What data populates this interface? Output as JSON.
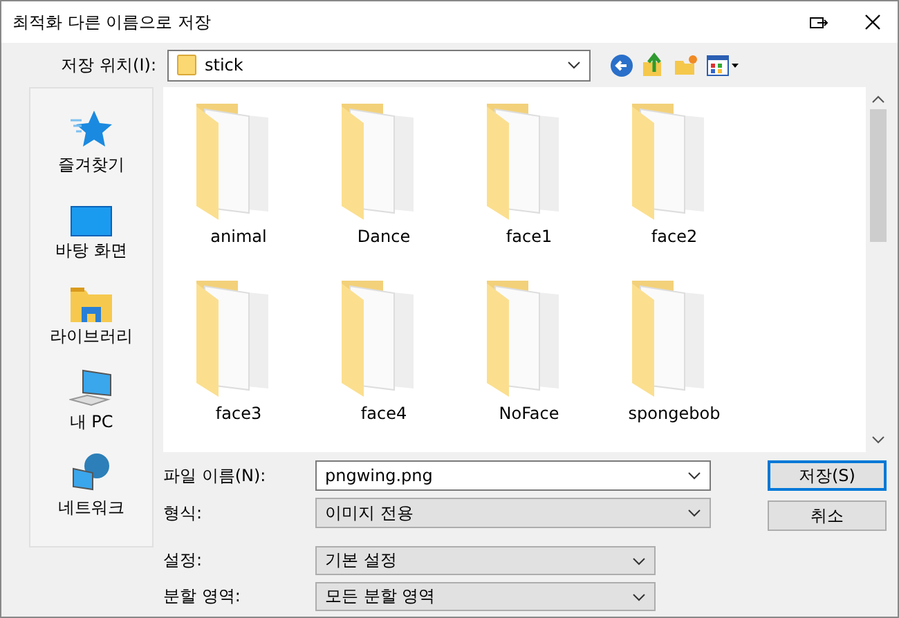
{
  "window": {
    "title": "최적화 다른 이름으로 저장"
  },
  "location": {
    "label": "저장 위치(I):",
    "value": "stick"
  },
  "sidebar": {
    "items": [
      {
        "label": "즐겨찾기",
        "kind": "star"
      },
      {
        "label": "바탕 화면",
        "kind": "desktop"
      },
      {
        "label": "라이브러리",
        "kind": "library"
      },
      {
        "label": "내 PC",
        "kind": "pc"
      },
      {
        "label": "네트워크",
        "kind": "network"
      }
    ]
  },
  "files": [
    {
      "name": "animal"
    },
    {
      "name": "Dance"
    },
    {
      "name": "face1"
    },
    {
      "name": "face2"
    },
    {
      "name": "face3"
    },
    {
      "name": "face4"
    },
    {
      "name": "NoFace"
    },
    {
      "name": "spongebob"
    }
  ],
  "fields": [
    {
      "label": "파일 이름(N):",
      "value": "pngwing.png",
      "kind": "editable"
    },
    {
      "label": "형식:",
      "value": "이미지 전용",
      "kind": "select"
    }
  ],
  "options": [
    {
      "label": "설정:",
      "value": "기본 설정"
    },
    {
      "label": "분할 영역:",
      "value": "모든 분할 영역"
    }
  ],
  "buttons": [
    {
      "label": "저장(S)",
      "default": true
    },
    {
      "label": "취소",
      "default": false
    }
  ]
}
